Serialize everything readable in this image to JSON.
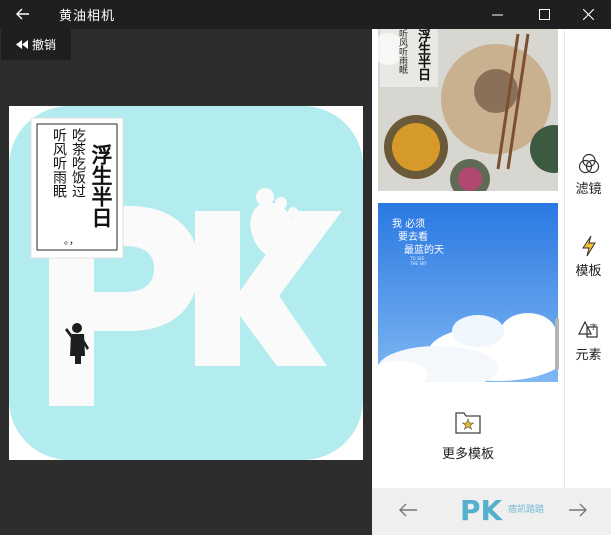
{
  "window": {
    "title": "黄油相机"
  },
  "toolbar": {
    "undo_label": "撤销"
  },
  "poster": {
    "columns": [
      "吃茶吃饭过",
      "听风听雨眠"
    ],
    "stamp_text": "浮生半日",
    "footer_mark": "。，",
    "big_letters": "PK"
  },
  "templates": {
    "card2_lines": [
      "我 必须",
      "要去看",
      "最蓝的天"
    ],
    "card2_small": "TO SEE\nTHE SKY",
    "more_label": "更多模板"
  },
  "side_tools": [
    {
      "label": "滤镜",
      "icon": "filter-circles-icon"
    },
    {
      "label": "模板",
      "icon": "lightning-icon"
    },
    {
      "label": "元素",
      "icon": "shapes-icon"
    }
  ],
  "colors": {
    "titlebar": "#1f1f1f",
    "canvas_bg": "#b2ecee",
    "accent": "#3aa6c8"
  },
  "watermark": {
    "brand": "PK",
    "site": "痞凯踏踏"
  }
}
